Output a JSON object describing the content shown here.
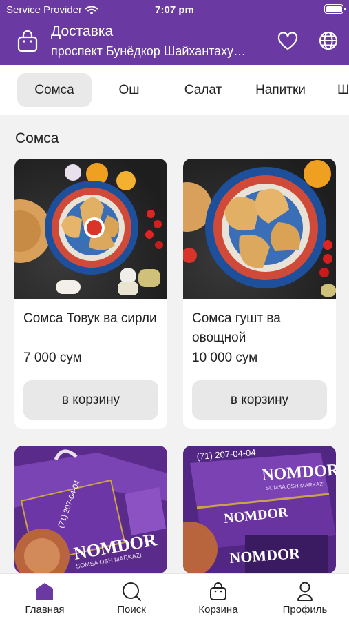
{
  "status": {
    "carrier": "Service Provider",
    "time": "7:07 pm"
  },
  "header": {
    "title": "Доставка",
    "address": "проспект Бунёдкор Шайхантахурский район"
  },
  "tabs": [
    {
      "label": "Сомса",
      "active": true
    },
    {
      "label": "Ош",
      "active": false
    },
    {
      "label": "Салат",
      "active": false
    },
    {
      "label": "Напитки",
      "active": false
    },
    {
      "label": "Ш",
      "active": false
    }
  ],
  "section": {
    "title": "Сомса"
  },
  "products": [
    {
      "name": "Сомса Товук ва сирли",
      "price": "7 000 сум",
      "button": "в корзину"
    },
    {
      "name": "Сомса гушт ва овощной",
      "price": "10 000 сум",
      "button": "в корзину"
    },
    {
      "name": "",
      "price": "",
      "button": ""
    },
    {
      "name": "",
      "price": "",
      "button": ""
    }
  ],
  "box_branding": {
    "brand": "NOMDOR",
    "tagline": "SOMSA OSH MARKAZI",
    "phone": "(71) 207-04-04"
  },
  "tabbar": [
    {
      "label": "Главная",
      "icon": "home-icon",
      "active": true
    },
    {
      "label": "Поиск",
      "icon": "search-icon",
      "active": false
    },
    {
      "label": "Корзина",
      "icon": "basket-icon",
      "active": false
    },
    {
      "label": "Профиль",
      "icon": "profile-icon",
      "active": false
    }
  ],
  "colors": {
    "brand": "#6a3aa2",
    "background": "#f2f2f2",
    "button": "#e8e8e8"
  }
}
